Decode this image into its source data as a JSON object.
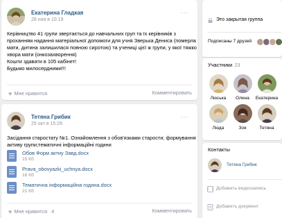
{
  "posts": [
    {
      "author": "Екатерина Гладкая",
      "date": "28 ноя в 10:19",
      "more_glyph": "···",
      "text_lines": [
        "Керівництво 41 групи звертається до навчальних груп та їх керівників з",
        "проханням надання матеріальної допомоги для учня Зверька Дениса (померла",
        "мати, дитина залишилася повною сиротою) та учениці цієї ж групи, у якої тяжко",
        "хвора мати (онкозахворення)",
        "Кошти здавати в 105 кабінет!",
        "Будьмо милосердними!!!"
      ],
      "like_label": "Мне нравится",
      "like_count": "",
      "comment_label": "Комментировать"
    },
    {
      "author": "Тетяна Грибик",
      "date": "25 окт в 15:26",
      "more_glyph": "···",
      "text_lines": [
        "Засідання старостату №1. Ознайомлення з обов'язками старости; формування",
        "активу групи;тематичні інформаційні години"
      ],
      "documents": [
        {
          "name": "Обов Форм актиу Завд.docx",
          "size": "15 Кб"
        },
        {
          "name": "Prava_obovyazki_uchnya.docx",
          "size": "18 Кб"
        },
        {
          "name": "Тематична інформаційна година.docx",
          "size": "21 Кб"
        }
      ],
      "like_label": "Мне нравится",
      "like_count": "4",
      "comment_label": "Комментировать"
    }
  ],
  "sidebar": {
    "closed_group_label": "Это закрытая группа",
    "subscribed_label": "Подписаны 7 друзей",
    "members_title": "Участники",
    "members_count": "23",
    "members": [
      {
        "name": "Люська"
      },
      {
        "name": "Олена"
      },
      {
        "name": "Екатерина"
      },
      {
        "name": "Люда"
      },
      {
        "name": "Зоя"
      },
      {
        "name": "Тетяна"
      }
    ],
    "contacts_title": "Контакты",
    "contact_name": "Тетяна Грибик",
    "add_video_label": "Добавить видеозапись",
    "add_doc_label": "Добавить документ"
  },
  "colors": {
    "link": "#2a5885",
    "muted": "#939393",
    "background": "#edeef0",
    "doc_icon": "#6c8fc6"
  }
}
